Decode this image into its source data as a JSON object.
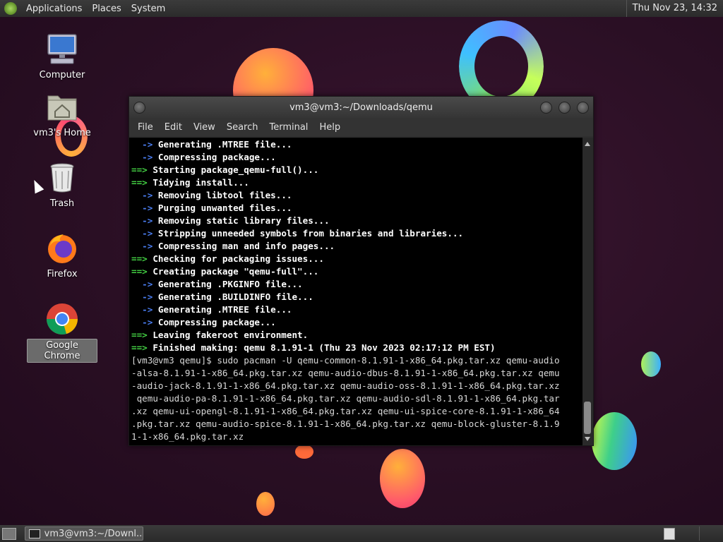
{
  "top_panel": {
    "menus": [
      "Applications",
      "Places",
      "System"
    ],
    "clock": "Thu Nov 23, 14:32"
  },
  "desktop_icons": [
    {
      "label": "Computer",
      "icon": "computer-icon"
    },
    {
      "label": "vm3's Home",
      "icon": "home-folder-icon"
    },
    {
      "label": "Trash",
      "icon": "trash-icon"
    },
    {
      "label": "Firefox",
      "icon": "firefox-icon"
    },
    {
      "label": "Google Chrome",
      "icon": "chrome-icon"
    }
  ],
  "terminal": {
    "title": "vm3@vm3:~/Downloads/qemu",
    "menus": [
      "File",
      "Edit",
      "View",
      "Search",
      "Terminal",
      "Help"
    ],
    "lines": [
      {
        "prefix": "  ->",
        "text": " Generating .MTREE file..."
      },
      {
        "prefix": "  ->",
        "text": " Compressing package..."
      },
      {
        "prefix": "==>",
        "text": " Starting package_qemu-full()..."
      },
      {
        "prefix": "==>",
        "text": " Tidying install..."
      },
      {
        "prefix": "  ->",
        "text": " Removing libtool files..."
      },
      {
        "prefix": "  ->",
        "text": " Purging unwanted files..."
      },
      {
        "prefix": "  ->",
        "text": " Removing static library files..."
      },
      {
        "prefix": "  ->",
        "text": " Stripping unneeded symbols from binaries and libraries..."
      },
      {
        "prefix": "  ->",
        "text": " Compressing man and info pages..."
      },
      {
        "prefix": "==>",
        "text": " Checking for packaging issues..."
      },
      {
        "prefix": "==>",
        "text": " Creating package \"qemu-full\"..."
      },
      {
        "prefix": "  ->",
        "text": " Generating .PKGINFO file..."
      },
      {
        "prefix": "  ->",
        "text": " Generating .BUILDINFO file..."
      },
      {
        "prefix": "  ->",
        "text": " Generating .MTREE file..."
      },
      {
        "prefix": "  ->",
        "text": " Compressing package..."
      },
      {
        "prefix": "==>",
        "text": " Leaving fakeroot environment."
      },
      {
        "prefix": "==>",
        "text": " Finished making: qemu 8.1.91-1 (Thu 23 Nov 2023 02:17:12 PM EST)"
      }
    ],
    "command_lines": [
      "[vm3@vm3 qemu]$ sudo pacman -U qemu-common-8.1.91-1-x86_64.pkg.tar.xz qemu-audio",
      "-alsa-8.1.91-1-x86_64.pkg.tar.xz qemu-audio-dbus-8.1.91-1-x86_64.pkg.tar.xz qemu",
      "-audio-jack-8.1.91-1-x86_64.pkg.tar.xz qemu-audio-oss-8.1.91-1-x86_64.pkg.tar.xz",
      " qemu-audio-pa-8.1.91-1-x86_64.pkg.tar.xz qemu-audio-sdl-8.1.91-1-x86_64.pkg.tar",
      ".xz qemu-ui-opengl-8.1.91-1-x86_64.pkg.tar.xz qemu-ui-spice-core-8.1.91-1-x86_64",
      ".pkg.tar.xz qemu-audio-spice-8.1.91-1-x86_64.pkg.tar.xz qemu-block-gluster-8.1.9",
      "1-1-x86_64.pkg.tar.xz"
    ]
  },
  "taskbar": {
    "task_label": "vm3@vm3:~/Downl..."
  }
}
